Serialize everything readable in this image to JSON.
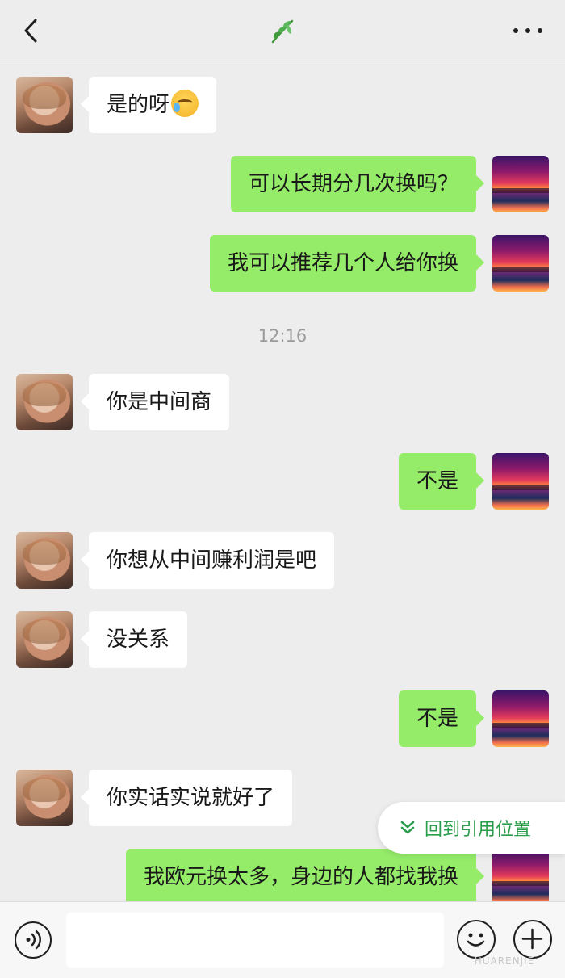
{
  "header": {
    "back_icon": "chevron-left-icon",
    "center_icon": "leaf-icon",
    "more_icon": "more-dots-icon"
  },
  "timestamp": "12:16",
  "messages": [
    {
      "side": "left",
      "text": "是的呀",
      "emoji": "crying-laughing-emoji"
    },
    {
      "side": "right",
      "text": "可以长期分几次换吗？"
    },
    {
      "side": "right",
      "text": "我可以推荐几个人给你换"
    },
    {
      "side": "left",
      "text": "你是中间商"
    },
    {
      "side": "right",
      "text": "不是"
    },
    {
      "side": "left",
      "text": "你想从中间赚利润是吧"
    },
    {
      "side": "left",
      "text": "没关系"
    },
    {
      "side": "right",
      "text": "不是"
    },
    {
      "side": "left",
      "text": "你实话实说就好了"
    },
    {
      "side": "right",
      "text": "我欧元换太多，身边的人都找我换"
    }
  ],
  "jump_button": {
    "label": "回到引用位置",
    "icon": "double-chevron-down-icon",
    "color": "#2a9d4a"
  },
  "input_bar": {
    "voice_icon": "voice-icon",
    "emoji_icon": "emoji-icon",
    "plus_icon": "plus-icon"
  },
  "watermark": "HUARENJIE",
  "colors": {
    "background": "#ededed",
    "incoming_bubble": "#ffffff",
    "outgoing_bubble": "#95ec69"
  }
}
